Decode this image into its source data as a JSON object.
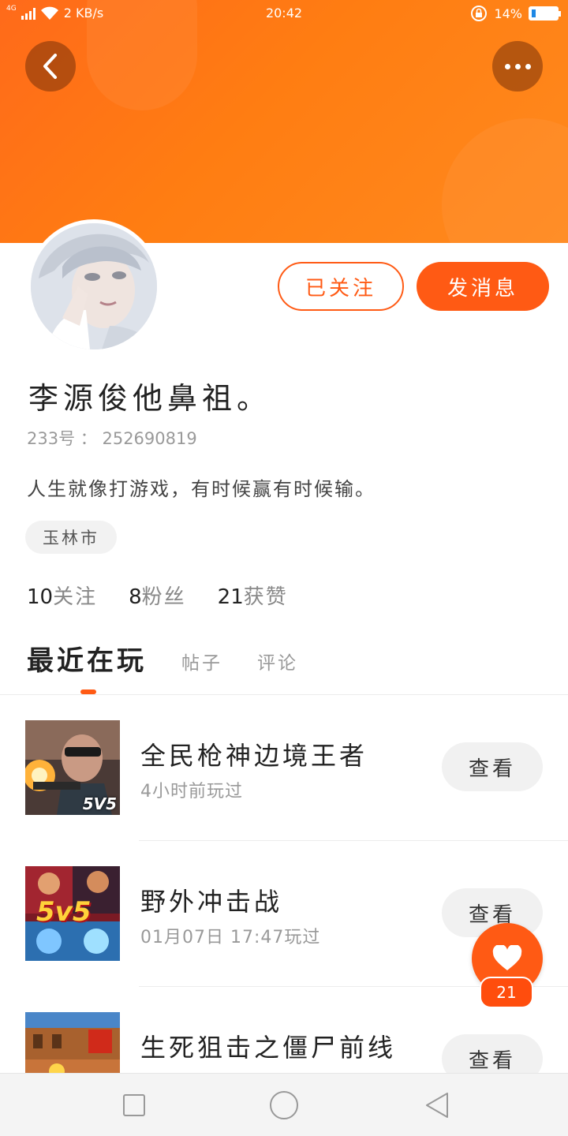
{
  "status_bar": {
    "network": "4G",
    "speed": "2 KB/s",
    "time": "20:42",
    "battery_percent": "14%",
    "battery_level": 0.14
  },
  "profile": {
    "following_button": "已关注",
    "message_button": "发消息",
    "username": "李源俊他鼻祖。",
    "uid_label": "233号",
    "uid_separator": "：",
    "uid_value": "252690819",
    "bio": "人生就像打游戏，有时候赢有时候输。",
    "city": "玉林市",
    "stats": [
      {
        "num": "10",
        "label": "关注"
      },
      {
        "num": "8",
        "label": "粉丝"
      },
      {
        "num": "21",
        "label": "获赞"
      }
    ]
  },
  "tabs": {
    "active": "最近在玩",
    "posts": "帖子",
    "comments": "评论"
  },
  "games": [
    {
      "name": "全民枪神边境王者",
      "time": "4小时前玩过",
      "action": "查看",
      "badge": "5V5"
    },
    {
      "name": "野外冲击战",
      "time": "01月07日 17:47玩过",
      "action": "查看",
      "badge": "5v5"
    },
    {
      "name": "生死狙击之僵尸前线",
      "time": "",
      "action": "查看",
      "badge": ""
    }
  ],
  "like_count": "21",
  "colors": {
    "accent": "#ff5a14",
    "banner": "#ff7d12"
  }
}
